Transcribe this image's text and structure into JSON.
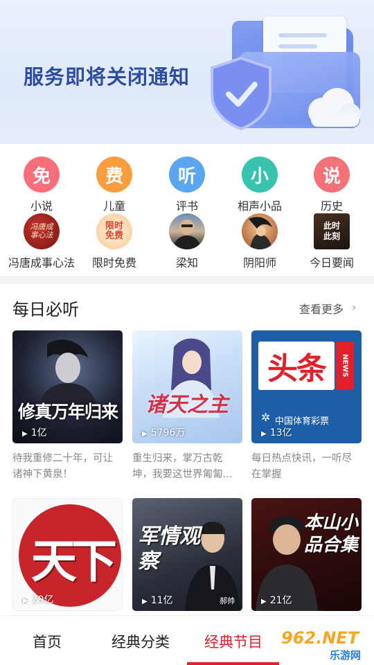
{
  "banner": {
    "title": "服务即将关闭通知"
  },
  "categories": [
    {
      "glyph": "免",
      "label": "小说",
      "color": "#f86e7a"
    },
    {
      "glyph": "费",
      "label": "儿童",
      "color": "#fb9d3f"
    },
    {
      "glyph": "听",
      "label": "评书",
      "color": "#5ba6ee"
    },
    {
      "glyph": "小",
      "label": "相声小品",
      "color": "#37c3ae"
    },
    {
      "glyph": "说",
      "label": "历史",
      "color": "#f47277"
    }
  ],
  "channels": [
    {
      "label": "冯唐成事心法",
      "art": "冯唐成事心法"
    },
    {
      "label": "限时免费",
      "art": "限时免费"
    },
    {
      "label": "梁知",
      "art": ""
    },
    {
      "label": "阴阳师",
      "art": ""
    },
    {
      "label": "今日要闻",
      "art": "此时此刻"
    }
  ],
  "daily": {
    "title": "每日必听",
    "more_label": "查看更多",
    "items": [
      {
        "cover_text": "修真万年归来",
        "plays": "1亿",
        "desc": "待我重修二十年，可让诸神下黄泉！"
      },
      {
        "cover_text": "诸天之主",
        "plays": "5796万",
        "desc": "重生归来，掌万古乾坤，我要这世界匍匐..."
      },
      {
        "cover_text": "头条",
        "cover_sub": "中国体育彩票",
        "plays": "13亿",
        "desc": "每日热点快讯，一听尽在掌握"
      },
      {
        "cover_text": "天下",
        "plays": "29亿",
        "desc": ""
      },
      {
        "cover_text": "军情观察",
        "cover_sub": "郝帅",
        "plays": "11亿",
        "desc": ""
      },
      {
        "cover_text": "本山小品合集",
        "plays": "21亿",
        "desc": ""
      }
    ]
  },
  "nav": {
    "tabs": [
      "首页",
      "经典分类",
      "经典节目"
    ],
    "active_index": 2
  },
  "watermark": {
    "text": "962.NET",
    "sub": "乐游网"
  },
  "colors": {
    "accent": "#e0202a",
    "banner_text": "#2c4da0"
  }
}
